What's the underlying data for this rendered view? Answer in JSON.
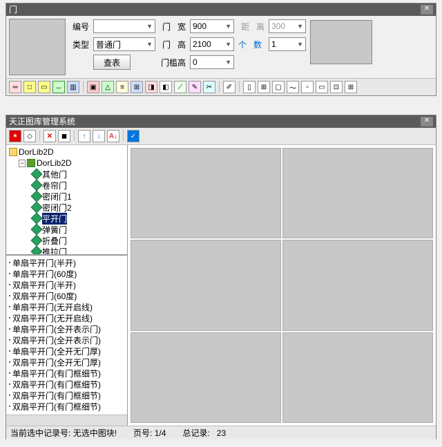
{
  "top": {
    "title": "门",
    "labels": {
      "num": "编号",
      "type": "类型",
      "lookup": "查表",
      "door": "门",
      "width": "宽",
      "height": "高",
      "threshold": "门槛高",
      "distance": "距",
      "from": "离",
      "count_unit": "个",
      "count": "数"
    },
    "values": {
      "num": "",
      "type": "普通门",
      "width": "900",
      "height": "2100",
      "threshold": "0",
      "distance": "300",
      "count": "1"
    }
  },
  "lib": {
    "title": "天正图库管理系统",
    "tree": {
      "root": "DorLib2D",
      "root2": "DorLib2D",
      "items": [
        "其他门",
        "卷帘门",
        "密闭门1",
        "密闭门2",
        "平开门",
        "弹簧门",
        "折叠门",
        "推拉门"
      ],
      "selected": "平开门"
    },
    "list": [
      "单扇平开门(半开)",
      "单扇平开门(60度)",
      "双扇平开门(半开)",
      "双扇平开门(60度)",
      "单扇平开门(无开启线)",
      "双扇平开门(无开启线)",
      "单扇平开门(全开表示门)",
      "双扇平开门(全开表示门)",
      "单扇平开门(全开无门厚)",
      "双扇平开门(全开无门厚)",
      "单扇平开门(有门框细节)",
      "双扇平开门(有门框细节)",
      "双扇平开门(有门框细节)",
      "双扇平开门(有门框细节)"
    ],
    "status": {
      "selection_label": "当前选中记录号:",
      "selection_value": "无选中图块!",
      "page_label": "页号:",
      "page_value": "1/4",
      "total_label": "总记录:",
      "total_value": "23"
    }
  }
}
